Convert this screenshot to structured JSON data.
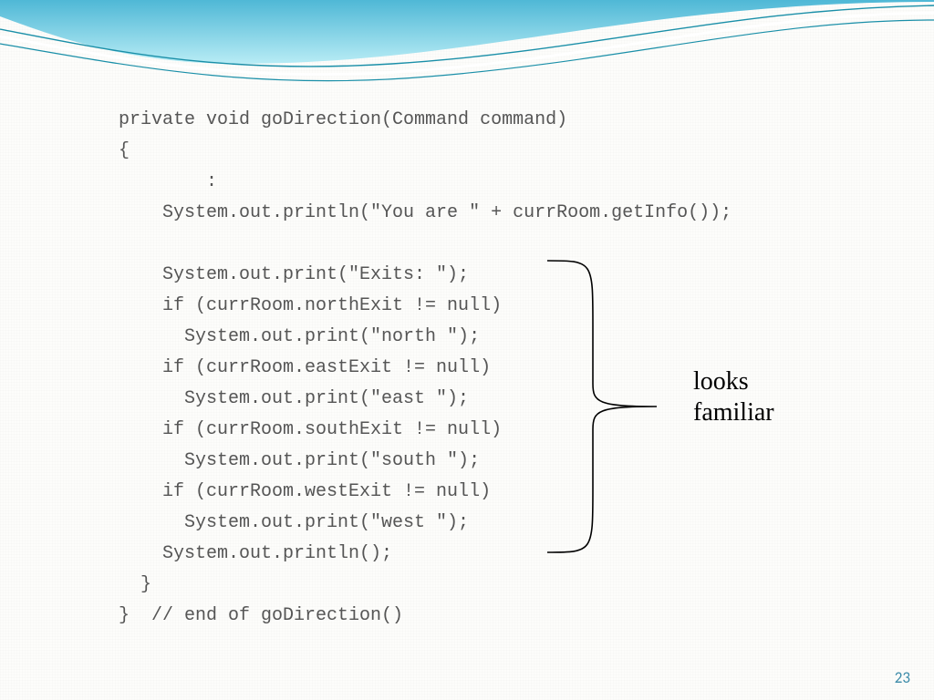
{
  "code": {
    "lines": [
      "private void goDirection(Command command)",
      "{",
      "        :",
      "    System.out.println(\"You are \" + currRoom.getInfo());",
      "",
      "    System.out.print(\"Exits: \");",
      "    if (currRoom.northExit != null)",
      "      System.out.print(\"north \");",
      "    if (currRoom.eastExit != null)",
      "      System.out.print(\"east \");",
      "    if (currRoom.southExit != null)",
      "      System.out.print(\"south \");",
      "    if (currRoom.westExit != null)",
      "      System.out.print(\"west \");",
      "    System.out.println();",
      "  }",
      "}  // end of goDirection()"
    ]
  },
  "annotation": {
    "line1": "looks",
    "line2": "familiar"
  },
  "pageNumber": "23",
  "colors": {
    "wave_fill": "#7fd3e6",
    "wave_line": "#1a8fa8",
    "code_text": "#555555",
    "page_num": "#3a8aa8"
  }
}
